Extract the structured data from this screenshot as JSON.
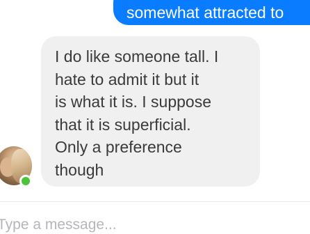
{
  "conversation": {
    "outgoing_message": "somewhat attracted to",
    "incoming_message_lines": [
      "I do like someone tall. I",
      "hate to admit it but it",
      "is what it is. I suppose",
      "that it is superficial.",
      "Only a preference",
      "though"
    ],
    "contact": {
      "status": "online",
      "status_color": "#4cc438"
    }
  },
  "composer": {
    "placeholder": "Type a message..."
  },
  "colors": {
    "outgoing_bubble": "#0a7cff",
    "incoming_bubble": "#f0f0f0"
  }
}
